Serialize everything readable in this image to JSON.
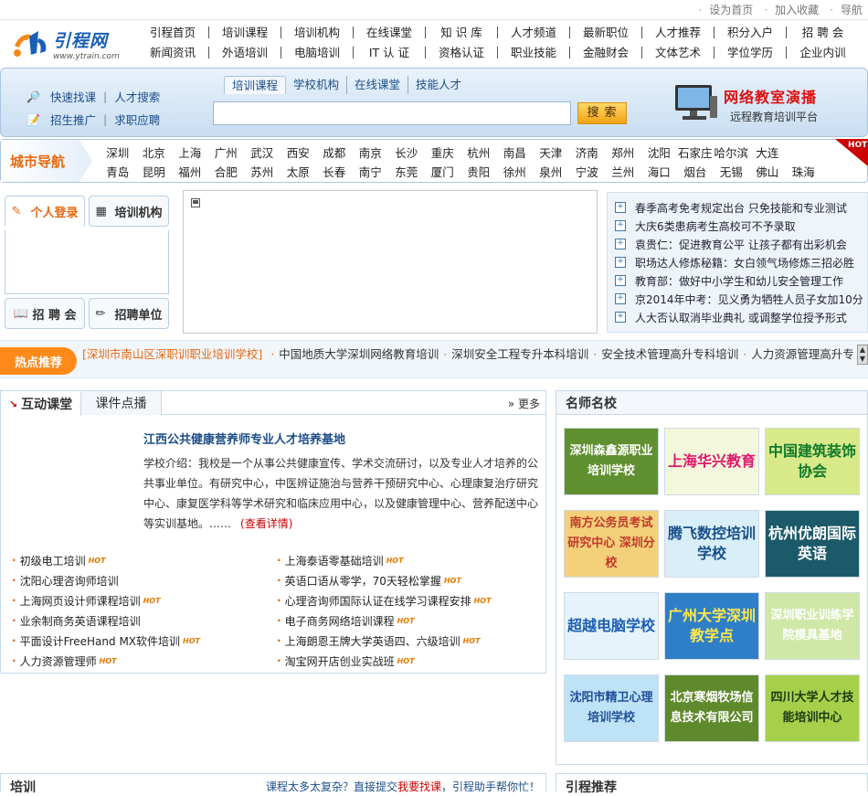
{
  "topbar": [
    "设为首页",
    "加入收藏",
    "导航"
  ],
  "logo": {
    "name": "引程网",
    "url": "www.ytrain.com"
  },
  "nav": {
    "row1": [
      "引程首页",
      "培训课程",
      "培训机构",
      "在线课堂",
      "知 识 库",
      "人才频道",
      "最新职位",
      "人才推荐",
      "积分入户",
      "招 聘 会"
    ],
    "row2": [
      "新闻资讯",
      "外语培训",
      "电脑培训",
      "IT 认 证",
      "资格认证",
      "职业技能",
      "金融财会",
      "文体艺术",
      "学位学历",
      "企业内训"
    ]
  },
  "quick": {
    "a1": "快速找课",
    "a2": "人才搜索",
    "b1": "招生推广",
    "b2": "求职应聘"
  },
  "search": {
    "tabs": [
      "培训课程",
      "学校机构",
      "在线课堂",
      "技能人才"
    ],
    "placeholder": "",
    "button": "搜索"
  },
  "promo": {
    "title": "网络教室演播",
    "subtitle": "远程教育培训平台"
  },
  "city": {
    "label": "城市导航",
    "hot": "HOTS",
    "row1": [
      "深圳",
      "北京",
      "上海",
      "广州",
      "武汉",
      "西安",
      "成都",
      "南京",
      "长沙",
      "重庆",
      "杭州",
      "南昌",
      "天津",
      "济南",
      "郑州",
      "沈阳",
      "石家庄",
      "哈尔滨",
      "大连"
    ],
    "row2": [
      "青岛",
      "昆明",
      "福州",
      "合肥",
      "苏州",
      "太原",
      "长春",
      "南宁",
      "东莞",
      "厦门",
      "贵阳",
      "徐州",
      "泉州",
      "宁波",
      "兰州",
      "海口",
      "烟台",
      "无锡",
      "佛山",
      "珠海"
    ]
  },
  "login": {
    "personal": "个人登录",
    "org": "培训机构",
    "fair": "招 聘 会",
    "employer": "招聘单位"
  },
  "news": [
    "春季高考免考规定出台 只免技能和专业测试",
    "大庆6类患病考生高校可不予录取",
    "袁贵仁：促进教育公平 让孩子都有出彩机会",
    "职场达人修炼秘籍：女白领气场修炼三招必胜",
    "教育部：做好中小学生和幼儿安全管理工作",
    "京2014年中考：见义勇为牺牲人员子女加10分",
    "人大否认取消毕业典礼 或调整学位授予形式"
  ],
  "hot": {
    "label": "热点推荐",
    "first": "[深圳市南山区深职训职业培训学校]",
    "items": [
      "中国地质大学深圳网络教育培训",
      "深圳安全工程专升本科培训",
      "安全技术管理高升专科培训",
      "人力资源管理高升专、专"
    ]
  },
  "classroom": {
    "tab1": "互动课堂",
    "tab2": "课件点播",
    "more": "更多",
    "school_title": "江西公共健康营养师专业人才培养基地",
    "school_desc": "学校介绍：我校是一个从事公共健康宣传、学术交流研讨，以及专业人才培养的公共事业单位。有研究中心，中医辨证施治与营养干预研究中心、心理康复治疗研究中心、康复医学科等学术研究和临床应用中心，以及健康管理中心、营养配送中心等实训基地。……",
    "detail": "(查看详情)",
    "hot_mark": "HOT",
    "courses": [
      "初级电工培训",
      "上海泰语零基础培训",
      "沈阳心理咨询师培训",
      "英语口语从零学，70天轻松掌握",
      "上海网页设计师课程培训",
      "心理咨询师国际认证在线学习课程安排",
      "业余制商务英语课程培训",
      "电子商务网络培训课程",
      "平面设计FreeHand MX软件培训",
      "上海朗恩王牌大学英语四、六级培训",
      "人力资源管理师",
      "淘宝网开店创业实战班"
    ],
    "course_hot": [
      true,
      true,
      false,
      true,
      true,
      true,
      false,
      true,
      true,
      true,
      true,
      true
    ]
  },
  "famous": {
    "title": "名师名校",
    "cards": [
      {
        "text": "深圳森鑫源职业培训学校",
        "bg": "#5f8f2e",
        "fg": "#ffffff"
      },
      {
        "text": "上海华兴教育",
        "bg": "#f3f8dc",
        "fg": "#e0186c"
      },
      {
        "text": "中国建筑装饰协会",
        "bg": "#d8e98a",
        "fg": "#0f7a2a"
      },
      {
        "text": "南方公务员考试研究中心 深圳分校",
        "bg": "#f4d07a",
        "fg": "#c0392b"
      },
      {
        "text": "腾飞数控培训学校",
        "bg": "#d8eef8",
        "fg": "#1a4f8a"
      },
      {
        "text": "杭州优朗国际英语",
        "bg": "#1c5a6a",
        "fg": "#ffffff"
      },
      {
        "text": "超越电脑学校",
        "bg": "#e6f3fb",
        "fg": "#1a5fb4"
      },
      {
        "text": "广州大学深圳教学点",
        "bg": "#2f7fc8",
        "fg": "#ffe84a"
      },
      {
        "text": "深圳职业训练学院模具基地",
        "bg": "#cfe8a8",
        "fg": "#ffffff"
      },
      {
        "text": "沈阳市精卫心理培训学校",
        "bg": "#bfe3f6",
        "fg": "#1f4f9a"
      },
      {
        "text": "北京寒烟牧场信息技术有限公司",
        "bg": "#5f8a2c",
        "fg": "#ffffff"
      },
      {
        "text": "四川大学人才技能培训中心",
        "bg": "#a7d04a",
        "fg": "#1a3a10"
      }
    ]
  },
  "bottom": {
    "left_title": "培训",
    "left_notice": "课程太多太复杂？直接提交",
    "left_link": "我要找课",
    "left_tail": "，引程助手帮你忙！",
    "right_title": "引程推荐"
  }
}
